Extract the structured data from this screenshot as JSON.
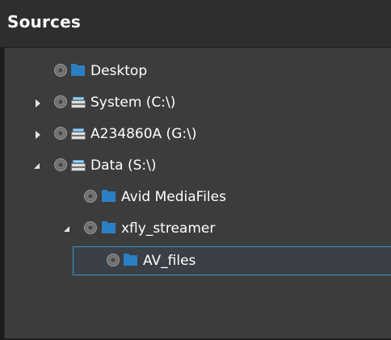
{
  "panel": {
    "title": "Sources"
  },
  "tree": {
    "items": [
      {
        "label": "Desktop",
        "icon": "folder-icon",
        "expander": "none"
      },
      {
        "label": "System (C:\\)",
        "icon": "drive-icon",
        "expander": "collapsed"
      },
      {
        "label": "A234860A (G:\\)",
        "icon": "drive-icon",
        "expander": "collapsed"
      },
      {
        "label": "Data (S:\\)",
        "icon": "drive-icon",
        "expander": "expanded"
      },
      {
        "label": "Avid MediaFiles",
        "icon": "folder-icon",
        "expander": "none"
      },
      {
        "label": "xfly_streamer",
        "icon": "folder-icon",
        "expander": "expanded"
      },
      {
        "label": "AV_files",
        "icon": "folder-icon",
        "expander": "none",
        "selected": true
      }
    ]
  },
  "colors": {
    "header_bg": "#2e2e2e",
    "tree_bg": "#3c3c3c",
    "folder": "#2b7fc4",
    "selection_border": "#3d95c8",
    "text": "#ffffff"
  }
}
